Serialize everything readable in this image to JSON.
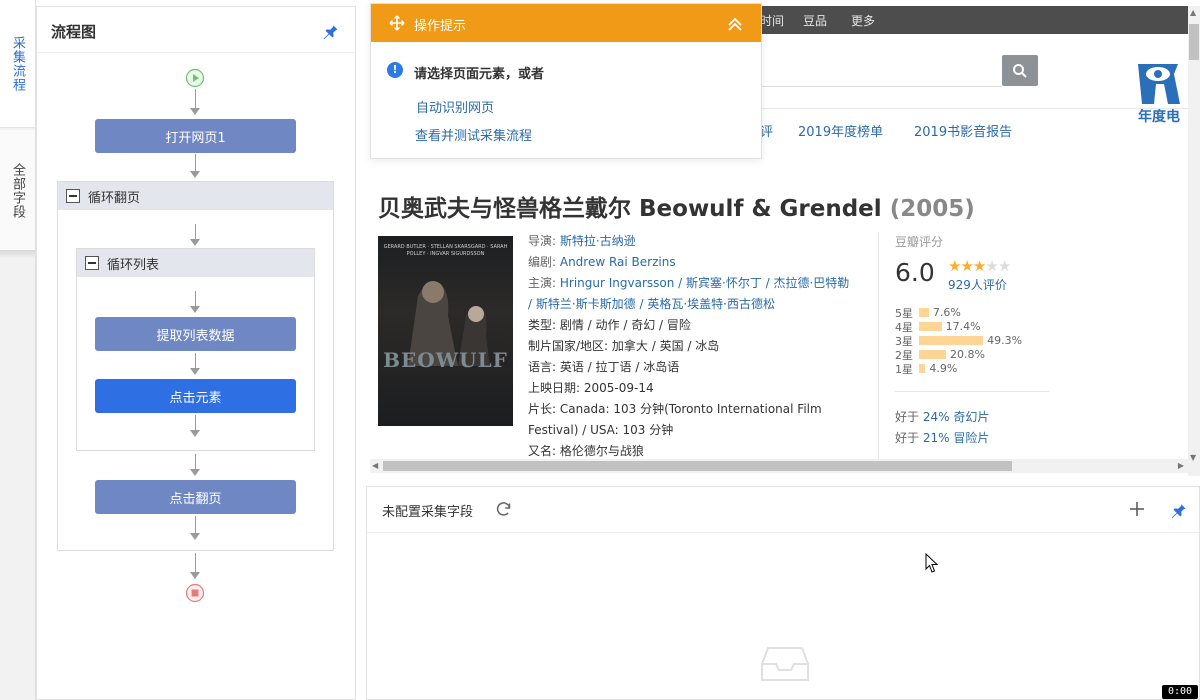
{
  "vtabs": {
    "collect_flow": "采集流程",
    "all_fields": "全部字段"
  },
  "flow": {
    "title": "流程图",
    "steps": {
      "open_page": "打开网页1",
      "loop_page": "循环翻页",
      "loop_list": "循环列表",
      "extract": "提取列表数据",
      "click_element": "点击元素",
      "click_next": "点击翻页"
    }
  },
  "browser": {
    "nav": [
      "时间",
      "豆品",
      "更多"
    ],
    "categories": [
      "评",
      "2019年度榜单",
      "2019书影音报告"
    ],
    "logo_text": "年度电",
    "movie": {
      "title": "贝奥武夫与怪兽格兰戴尔 Beowulf & Grendel",
      "year": "(2005)",
      "poster_text": "BEOWULF",
      "poster_names": "GERARD BUTLER · STELLAN SKARSGARD · SARAH POLLEY · INGVAR SIGURDSSON",
      "director_label": "导演: ",
      "director": "斯特拉·古纳逊",
      "writer_label": "编剧: ",
      "writer": "Andrew Rai Berzins",
      "cast_label": "主演: ",
      "cast1": "Hringur Ingvarsson / 斯宾塞·怀尔丁 / 杰拉德·巴特勒",
      "cast2": "/ 斯特兰·斯卡斯加德 / 英格瓦·埃盖特·西古德松",
      "genre": "类型: 剧情 / 动作 / 奇幻 / 冒险",
      "region": "制片国家/地区: 加拿大 / 英国 / 冰岛",
      "language": "语言: 英语 / 拉丁语 / 冰岛语",
      "release": "上映日期: 2005-09-14",
      "runtime1": "片长: Canada: 103 分钟(Toronto International Film",
      "runtime2": "Festival) / USA: 103 分钟",
      "aka": "又名: 格伦德尔与战狼"
    },
    "rating": {
      "label": "豆瓣评分",
      "score": "6.0",
      "votes": "929人评价",
      "stars_filled": 3,
      "rows": [
        {
          "label": "5星",
          "pct": "7.6%",
          "value": 7.6
        },
        {
          "label": "4星",
          "pct": "17.4%",
          "value": 17.4
        },
        {
          "label": "3星",
          "pct": "49.3%",
          "value": 49.3
        },
        {
          "label": "2星",
          "pct": "20.8%",
          "value": 20.8
        },
        {
          "label": "1星",
          "pct": "4.9%",
          "value": 4.9
        }
      ],
      "better_than": [
        {
          "prefix": "好于 ",
          "text": "24% 奇幻片"
        },
        {
          "prefix": "好于 ",
          "text": "21% 冒险片"
        }
      ]
    }
  },
  "tip": {
    "title": "操作提示",
    "message": "请选择页面元素，或者",
    "links": [
      "自动识别网页",
      "查看并测试采集流程"
    ]
  },
  "fields": {
    "title": "未配置采集字段"
  },
  "timer": "0:00"
}
